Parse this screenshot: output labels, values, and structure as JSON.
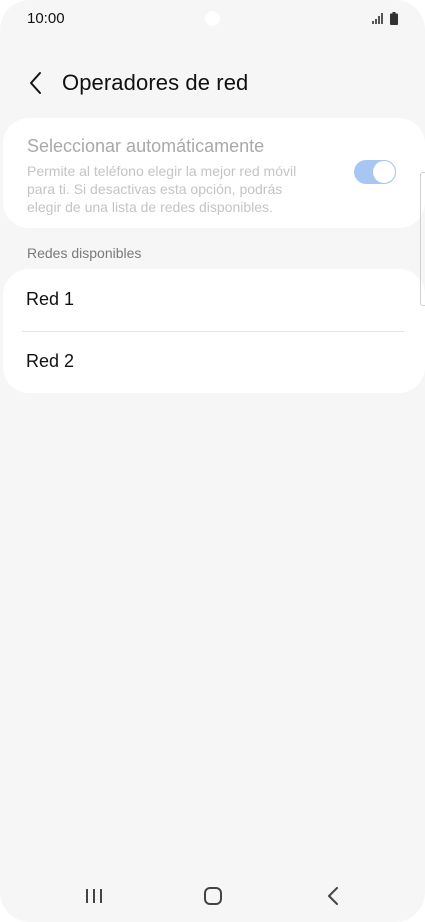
{
  "status_bar": {
    "time": "10:00",
    "icons": [
      "signal-icon",
      "battery-icon"
    ]
  },
  "header": {
    "back_icon": "chevron-left-icon",
    "title": "Operadores de red"
  },
  "auto_select": {
    "title": "Seleccionar automáticamente",
    "description": "Permite al teléfono elegir la mejor red móvil para ti. Si desactivas esta opción, podrás elegir de una lista de redes disponibles.",
    "toggle_on": true,
    "toggle_color": "#a7c7f2"
  },
  "available_networks": {
    "label": "Redes disponibles",
    "items": [
      {
        "label": "Red 1"
      },
      {
        "label": "Red 2"
      }
    ]
  },
  "nav_bar": {
    "icons": [
      "recents-icon",
      "home-icon",
      "back-icon"
    ]
  }
}
